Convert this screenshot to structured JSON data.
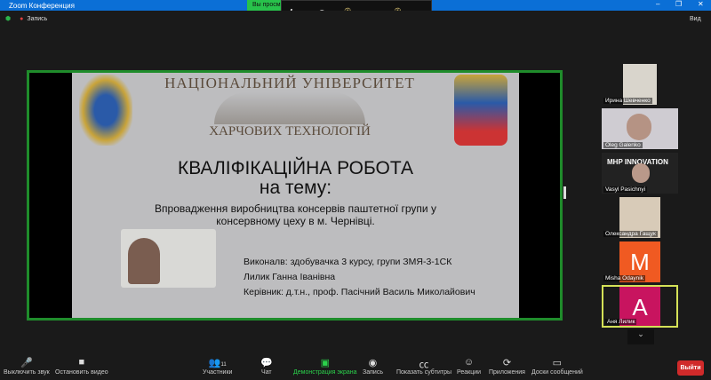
{
  "window": {
    "title": "Zoom Конференция",
    "minimize": "–",
    "restore": "❐",
    "close": "✕"
  },
  "banner": "Вы просм",
  "hp_toolbar": {
    "logo": "hp"
  },
  "topbar": {
    "record_label": "Запись",
    "view_label": "Вид"
  },
  "slide": {
    "university_line1": "НАЦІОНАЛЬНИЙ УНІВЕРСИТЕТ",
    "university_line2": "ХАРЧОВИХ ТЕХНОЛОГІЙ",
    "title": "КВАЛІФІКАЦІЙНА РОБОТА",
    "subtitle": "на тему:",
    "topic_line1": "Впровадження виробництва консервів  паштетної групи у",
    "topic_line2": "консервному цеху в м. Чернівці.",
    "performer": "Виконалв: здобувачка 3 курсу, групи ЗМЯ-3-1СК",
    "student": "Лилик Ганна Іванівна",
    "supervisor": "Керівник: д.т.н., проф. Пасічний Василь Миколайович"
  },
  "participants": [
    {
      "name": "Ирина Шевченко"
    },
    {
      "name": "Oleg Galenko"
    },
    {
      "name": "Vasyl Pasichnyi"
    },
    {
      "name": "Олександра Гащук"
    },
    {
      "name": "Misha Odaynik",
      "initial": "M",
      "color": "#f05a22"
    },
    {
      "name": "Аня Лилик",
      "initial": "A",
      "color": "#c8145f"
    }
  ],
  "toolbar": {
    "mute": "Выключить звук",
    "video": "Остановить видео",
    "participants": "Участники",
    "participants_count": "11",
    "chat": "Чат",
    "share": "Демонстрация экрана",
    "record": "Запись",
    "captions": "Показать субтитры",
    "reactions": "Реакции",
    "apps": "Приложения",
    "whiteboard": "Доски сообщений",
    "leave": "Выйти"
  }
}
